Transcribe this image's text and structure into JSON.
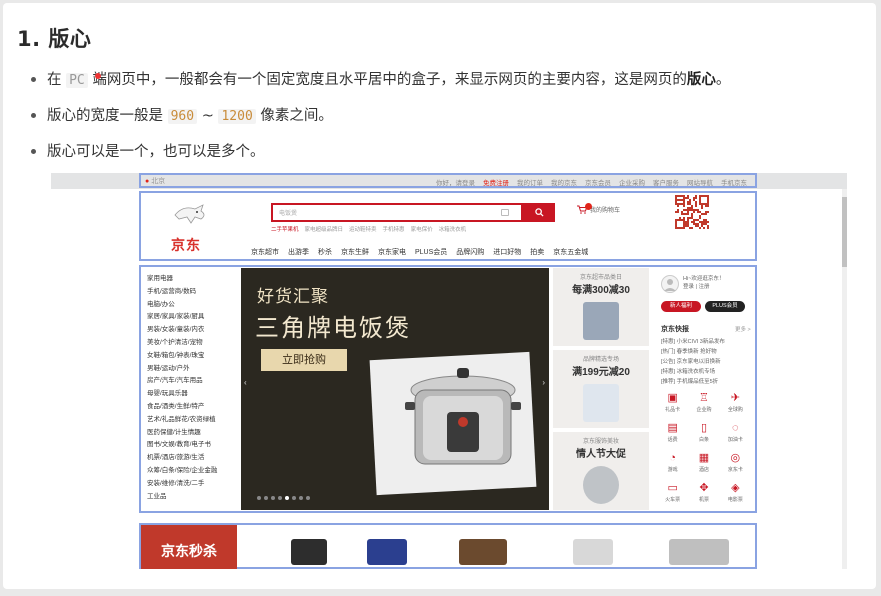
{
  "heading": "1. 版心",
  "bullets": {
    "b1": {
      "pre": "在 ",
      "code": "PC",
      "mid": " 端网页中，一般都会有一个固定宽度且水平居中的盒子，来显示网页的主要内容，这是网页的",
      "strong": "版心",
      "post": "。"
    },
    "b2": {
      "pre": "版心的宽度一般是 ",
      "code_from": "960",
      "sep": " ~ ",
      "code_to": "1200",
      "post": " 像素之间。"
    },
    "b3": {
      "text": "版心可以是一个，也可以是多个。"
    }
  },
  "screenshot": {
    "topbar": {
      "location": "北京",
      "items": [
        "你好，请登录",
        "免费注册",
        "我的订单",
        "我的京东",
        "京东会员",
        "企业采购",
        "客户服务",
        "网站导航",
        "手机京东"
      ]
    },
    "header": {
      "logo_text": "京东",
      "search_placeholder": "电饭煲",
      "search_button_icon": "search-icon",
      "hotwords": [
        "二手苹果机",
        "家电超级品牌日",
        "运动鞋特卖",
        "手机特惠",
        "家电保价",
        "冰箱洗衣机"
      ],
      "cart_label": "我的购物车",
      "nav": [
        "京东超市",
        "出游季",
        "秒杀",
        "京东生鲜",
        "京东家电",
        "PLUS会员",
        "品牌闪购",
        "进口好物",
        "拍卖",
        "京东五金城"
      ]
    },
    "categories": [
      "家用电器",
      "手机/运营商/数码",
      "电脑/办公",
      "家居/家具/家装/厨具",
      "男装/女装/童装/内衣",
      "美妆/个护清洁/宠物",
      "女鞋/箱包/钟表/珠宝",
      "男鞋/运动/户外",
      "房产/汽车/汽车用品",
      "母婴/玩具乐器",
      "食品/酒类/生鲜/特产",
      "艺术/礼品鲜花/农资绿植",
      "医药保健/计生情趣",
      "图书/文娱/教育/电子书",
      "机票/酒店/旅游/生活",
      "众筹/白条/保险/企业金融",
      "安装/维修/清洗/二手",
      "工业品"
    ],
    "banner": {
      "title1": "好货汇聚",
      "title2": "三角牌电饭煲",
      "button": "立即抢购"
    },
    "promos": [
      {
        "small": "京东超市品类日",
        "big": "每满300减30"
      },
      {
        "small": "品牌精选专场",
        "big": "满199元减20"
      },
      {
        "small": "京东服饰美妆",
        "big": "情人节大促"
      }
    ],
    "right_panel": {
      "hello": "Hi~欢迎逛京东！",
      "login": "登录 | 注册",
      "btn_newcomer": "新人福利",
      "btn_plus": "PLUS会员",
      "news_title": "京东快报",
      "news_more": "更多 >",
      "news": [
        "[特惠] 小米CIVI 3新品发布",
        "[热门] 春季焕新 抢好物",
        "[公告] 京东家电以旧换新",
        "[特惠] 冰箱洗衣机专场",
        "[推荐] 手机爆品低至5折"
      ],
      "icons": [
        {
          "glyph": "▣",
          "label": "礼品卡"
        },
        {
          "glyph": "♖",
          "label": "企业购"
        },
        {
          "glyph": "✈",
          "label": "全球购"
        },
        {
          "glyph": "▤",
          "label": "话费"
        },
        {
          "glyph": "▯",
          "label": "白条"
        },
        {
          "glyph": "◌",
          "label": "加油卡"
        },
        {
          "glyph": "◔",
          "label": "游戏"
        },
        {
          "glyph": "▦",
          "label": "酒店"
        },
        {
          "glyph": "◎",
          "label": "京东卡"
        },
        {
          "glyph": "▭",
          "label": "火车票"
        },
        {
          "glyph": "✥",
          "label": "机票"
        },
        {
          "glyph": "◈",
          "label": "电影票"
        }
      ]
    },
    "seckill": {
      "label": "京东秒杀"
    }
  },
  "colors": {
    "jd_red": "#c81623",
    "highlight_box": "#8aa3e2",
    "code_orange": "#c98c3a"
  }
}
